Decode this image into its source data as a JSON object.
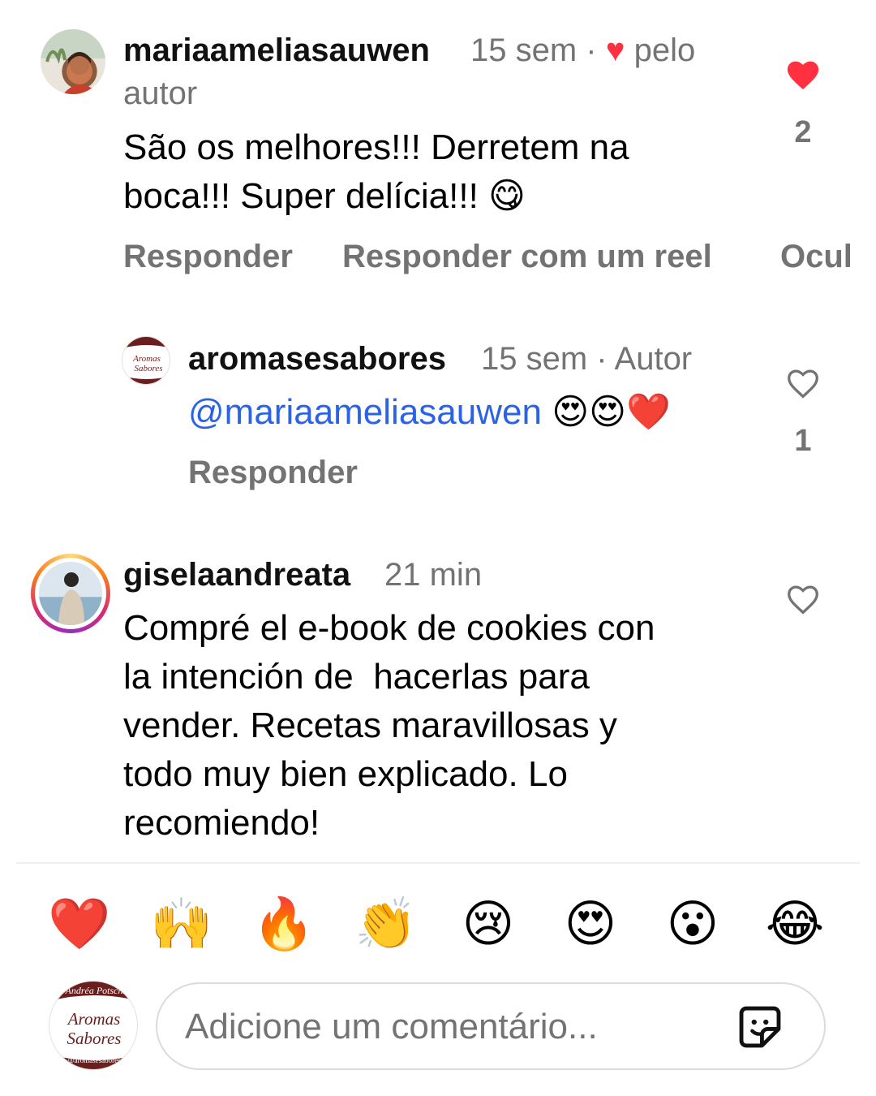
{
  "comments": [
    {
      "username": "mariaameliasauwen",
      "time": "15 sem",
      "separator": "·",
      "liked_by_author_text": "pelo",
      "liked_by_author_text2": "autor",
      "text_line1": "São os melhores!!! Derretem na",
      "text_line2": "boca!!! Super delícia!!!",
      "text_emoji": "😋",
      "like_count": "2",
      "actions": [
        "Responder",
        "Responder com um reel",
        "Ocul"
      ]
    },
    {
      "username": "aromasesabores",
      "time": "15 sem",
      "author_badge": "· Autor",
      "mention": "@mariaameliasauwen",
      "emojis": "😍😍❤️",
      "like_count": "1",
      "action": "Responder"
    },
    {
      "username": "giselaandreata",
      "time": "21 min",
      "text_lines": [
        "Compré el e-book de cookies con",
        "la intención de  hacerlas para",
        "vender. Recetas maravillosas y",
        "todo muy bien explicado. Lo",
        "recomiendo!"
      ]
    }
  ],
  "reaction_bar": [
    "❤️",
    "🙌",
    "🔥",
    "👏",
    "😢",
    "😍",
    "😮",
    "😂"
  ],
  "composer": {
    "placeholder": "Adicione um comentário...",
    "avatar_text_top": "Andréa Potsch",
    "avatar_text_main1": "Aromas",
    "avatar_text_main2": "Sabores",
    "avatar_text_bottom": "@aromasesabores",
    "sticker_icon": "sticker-icon"
  },
  "colors": {
    "like_red": "#ff3040",
    "mention_blue": "#2a63e6",
    "muted": "#737373",
    "brand_maroon": "#6b1e1e"
  }
}
